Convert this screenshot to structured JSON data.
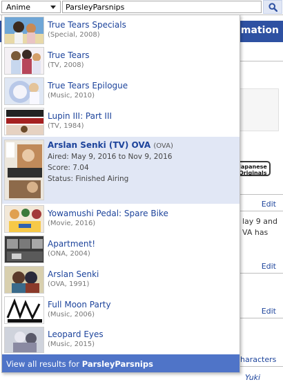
{
  "search": {
    "category": "Anime",
    "query": "ParsleyParsnips"
  },
  "background": {
    "header_text": "mation",
    "badge_line1": "Japanese",
    "badge_line2": "Originals",
    "edit_label": "Edit",
    "snippet_line1": "lay 9 and",
    "snippet_line2": "VA has",
    "characters_link": "haracters",
    "bottom_name": "Yuki"
  },
  "results": [
    {
      "title": "True Tears Specials",
      "meta": "(Special, 2008)"
    },
    {
      "title": "True Tears",
      "meta": "(TV, 2008)"
    },
    {
      "title": "True Tears Epilogue",
      "meta": "(Music, 2010)"
    },
    {
      "title": "Lupin III: Part III",
      "meta": "(TV, 1984)"
    },
    {
      "title": "Arslan Senki (TV) OVA",
      "type": "(OVA)",
      "aired": "Aired: May 9, 2016 to Nov 9, 2016",
      "score": "Score: 7.04",
      "status": "Status: Finished Airing"
    },
    {
      "title": "Yowamushi Pedal: Spare Bike",
      "meta": "(Movie, 2016)"
    },
    {
      "title": "Apartment!",
      "meta": "(ONA, 2004)"
    },
    {
      "title": "Arslan Senki",
      "meta": "(OVA, 1991)"
    },
    {
      "title": "Full Moon Party",
      "meta": "(Music, 2006)"
    },
    {
      "title": "Leopard Eyes",
      "meta": "(Music, 2015)"
    }
  ],
  "view_all": {
    "prefix": "View all results for ",
    "query": "ParsleyParsnips"
  },
  "colors": {
    "header_blue": "#2e51a2",
    "link_blue": "#1c439b",
    "highlight": "#e1e7f5",
    "view_all_bg": "#4f74c8"
  }
}
